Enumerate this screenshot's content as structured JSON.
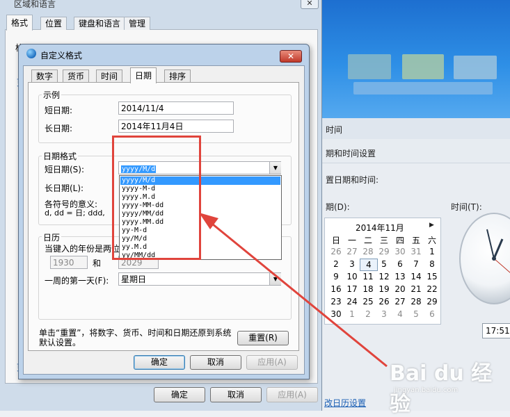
{
  "outer_window": {
    "title": "区域和语言",
    "close": "✕",
    "tabs": [
      "格式",
      "位置",
      "键盘和语言",
      "管理"
    ],
    "stub_texts": [
      "格",
      "更",
      "更"
    ],
    "buttons": {
      "ok": "确定",
      "cancel": "取消",
      "apply": "应用(A)"
    }
  },
  "dialog": {
    "title": "自定义格式",
    "close": "✕",
    "tabs": [
      "数字",
      "货币",
      "时间",
      "日期",
      "排序"
    ],
    "active_tab": "日期",
    "example": {
      "group": "示例",
      "short_label": "短日期:",
      "short_value": "2014/11/4",
      "long_label": "长日期:",
      "long_value": "2014年11月4日"
    },
    "date_formats": {
      "group": "日期格式",
      "short_label": "短日期(S):",
      "short_value": "yyyy/M/d",
      "long_label": "长日期(L):",
      "symbols_label": "各符号的意义:",
      "symbols_text": "d, dd = 日;  ddd,"
    },
    "dropdown": {
      "items": [
        "yyyy/M/d",
        "yyyy-M-d",
        "yyyy.M.d",
        "yyyy-MM-dd",
        "yyyy/MM/dd",
        "yyyy.MM.dd",
        "yy-M-d",
        "yy/M/d",
        "yy.M.d",
        "yy/MM/dd"
      ],
      "selected_index": 0
    },
    "calendar": {
      "group": "日历",
      "two_digit_label": "当键入的年份是两位",
      "year_from": "1930",
      "and_label": "和",
      "year_to": "2029",
      "first_day_label": "一周的第一天(F):",
      "first_day_value": "星期日"
    },
    "reset_note": "单击“重置”，将数字、货币、时间和日期还原到系统默认设置。",
    "reset_button": "重置(R)",
    "buttons": {
      "ok": "确定",
      "cancel": "取消",
      "apply": "应用(A)"
    }
  },
  "background_window": {
    "labels": [
      "时间",
      "期和时间设置",
      "置日期和时间:",
      "期(D):",
      "时间(T):"
    ],
    "calendar": {
      "title": "2014年11月",
      "weekdays": [
        "日",
        "一",
        "二",
        "三",
        "四",
        "五",
        "六"
      ],
      "rows": [
        [
          "26",
          "27",
          "28",
          "29",
          "30",
          "31",
          "1"
        ],
        [
          "2",
          "3",
          "4",
          "5",
          "6",
          "7",
          "8"
        ],
        [
          "9",
          "10",
          "11",
          "12",
          "13",
          "14",
          "15"
        ],
        [
          "16",
          "17",
          "18",
          "19",
          "20",
          "21",
          "22"
        ],
        [
          "23",
          "24",
          "25",
          "26",
          "27",
          "28",
          "29"
        ],
        [
          "30",
          "1",
          "2",
          "3",
          "4",
          "5",
          "6"
        ]
      ],
      "today": "4"
    },
    "time_text": "17:51:",
    "link_text": "改日历设置"
  },
  "watermark": {
    "main": "Bai du 经验",
    "sub": "jingyan.baidu.com"
  },
  "colors": {
    "annotation_red": "#e0443c",
    "selection_blue": "#3399ff"
  }
}
